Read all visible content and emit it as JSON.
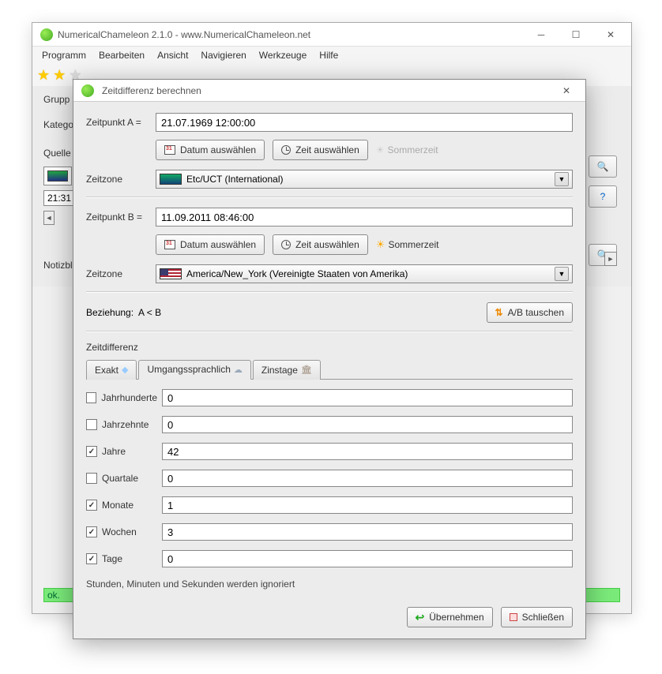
{
  "main": {
    "title": "NumericalChameleon 2.1.0 - www.NumericalChameleon.net",
    "menus": [
      "Programm",
      "Bearbeiten",
      "Ansicht",
      "Navigieren",
      "Werkzeuge",
      "Hilfe"
    ],
    "labels": {
      "gruppe": "Grupp",
      "kategorie": "Kategori",
      "quelle": "Quelle",
      "notiz": "Notizbloc"
    },
    "value": "21:31",
    "status": "ok."
  },
  "dialog": {
    "title": "Zeitdifferenz berechnen",
    "pointA": {
      "label": "Zeitpunkt A =",
      "value": "21.07.1969 12:00:00",
      "timezone_label": "Zeitzone",
      "timezone": "Etc/UCT (International)"
    },
    "pointB": {
      "label": "Zeitpunkt B =",
      "value": "11.09.2011 08:46:00",
      "timezone_label": "Zeitzone",
      "timezone": "America/New_York (Vereinigte Staaten von Amerika)"
    },
    "buttons": {
      "pickDate": "Datum auswählen",
      "pickTime": "Zeit auswählen",
      "dst": "Sommerzeit",
      "swap": "A/B tauschen",
      "apply": "Übernehmen",
      "close": "Schließen"
    },
    "relation": {
      "label": "Beziehung:",
      "value": "A < B"
    },
    "sectionLabel": "Zeitdifferenz",
    "tabs": [
      "Exakt",
      "Umgangssprachlich",
      "Zinstage"
    ],
    "units": [
      {
        "label": "Jahrhunderte",
        "checked": false,
        "value": "0"
      },
      {
        "label": "Jahrzehnte",
        "checked": false,
        "value": "0"
      },
      {
        "label": "Jahre",
        "checked": true,
        "value": "42"
      },
      {
        "label": "Quartale",
        "checked": false,
        "value": "0"
      },
      {
        "label": "Monate",
        "checked": true,
        "value": "1"
      },
      {
        "label": "Wochen",
        "checked": true,
        "value": "3"
      },
      {
        "label": "Tage",
        "checked": true,
        "value": "0"
      }
    ],
    "note": "Stunden, Minuten und Sekunden werden ignoriert"
  }
}
